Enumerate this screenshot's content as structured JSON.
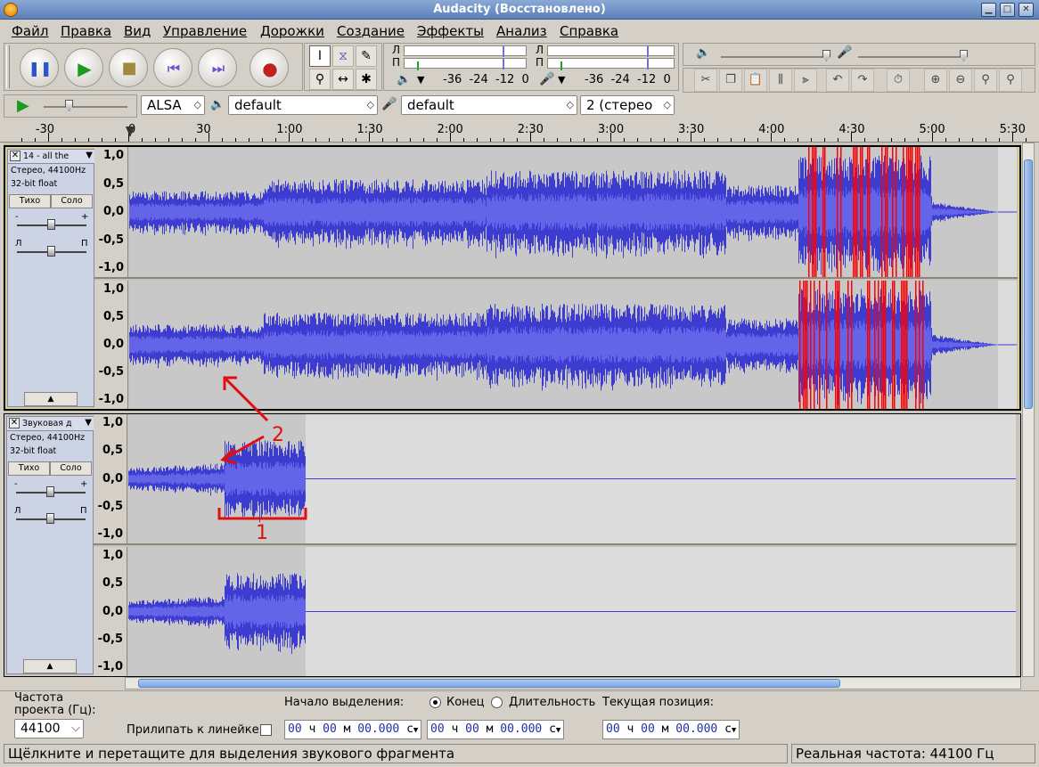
{
  "window": {
    "title": "Audacity (Восстановлено)"
  },
  "menu": [
    "Файл",
    "Правка",
    "Вид",
    "Управление",
    "Дорожки",
    "Создание",
    "Эффекты",
    "Анализ",
    "Справка"
  ],
  "meters": {
    "left_label": "Л",
    "right_label": "П",
    "scale": [
      "-36",
      "-24",
      "-12",
      "0"
    ]
  },
  "device": {
    "host": "ALSA",
    "output": "default",
    "input": "default",
    "channels": "2 (стерео"
  },
  "ruler": {
    "labels": [
      "-30",
      "0",
      "30",
      "1:00",
      "1:30",
      "2:00",
      "2:30",
      "3:00",
      "3:30",
      "4:00",
      "4:30",
      "5:00",
      "5:30"
    ]
  },
  "vscale": [
    "1,0",
    "0,5",
    "0,0",
    "-0,5",
    "-1,0"
  ],
  "tracks": [
    {
      "name": "14 - all the",
      "info1": "Стерео, 44100Hz",
      "info2": "32-bit float",
      "mute": "Тихо",
      "solo": "Соло",
      "pan_l": "Л",
      "pan_r": "П",
      "gain_minus": "-",
      "gain_plus": "+"
    },
    {
      "name": "Звуковая д",
      "info1": "Стерео, 44100Hz",
      "info2": "32-bit float",
      "mute": "Тихо",
      "solo": "Соло",
      "pan_l": "Л",
      "pan_r": "П",
      "gain_minus": "-",
      "gain_plus": "+"
    }
  ],
  "annotations": {
    "one": "1",
    "two": "2"
  },
  "selection": {
    "rate_label_1": "Частота",
    "rate_label_2": "проекта (Гц):",
    "rate_value": "44100",
    "snap_label": "Прилипать к линейке",
    "start_label": "Начало выделения:",
    "end_label": "Конец",
    "length_label": "Длительность",
    "pos_label": "Текущая позиция:",
    "time_h": "00",
    "time_h_u": "ч",
    "time_m": "00",
    "time_m_u": "м",
    "time_s": "00.000",
    "time_s_u": "с"
  },
  "status": {
    "hint": "Щёлкните и перетащите для выделения звукового фрагмента",
    "rate": "Реальная частота: 44100 Гц"
  },
  "colors": {
    "wave": "#3c3cd0",
    "wave_rms": "#6464e8",
    "clipping": "#ff0000",
    "selection_bg": "#c8c8c8"
  }
}
